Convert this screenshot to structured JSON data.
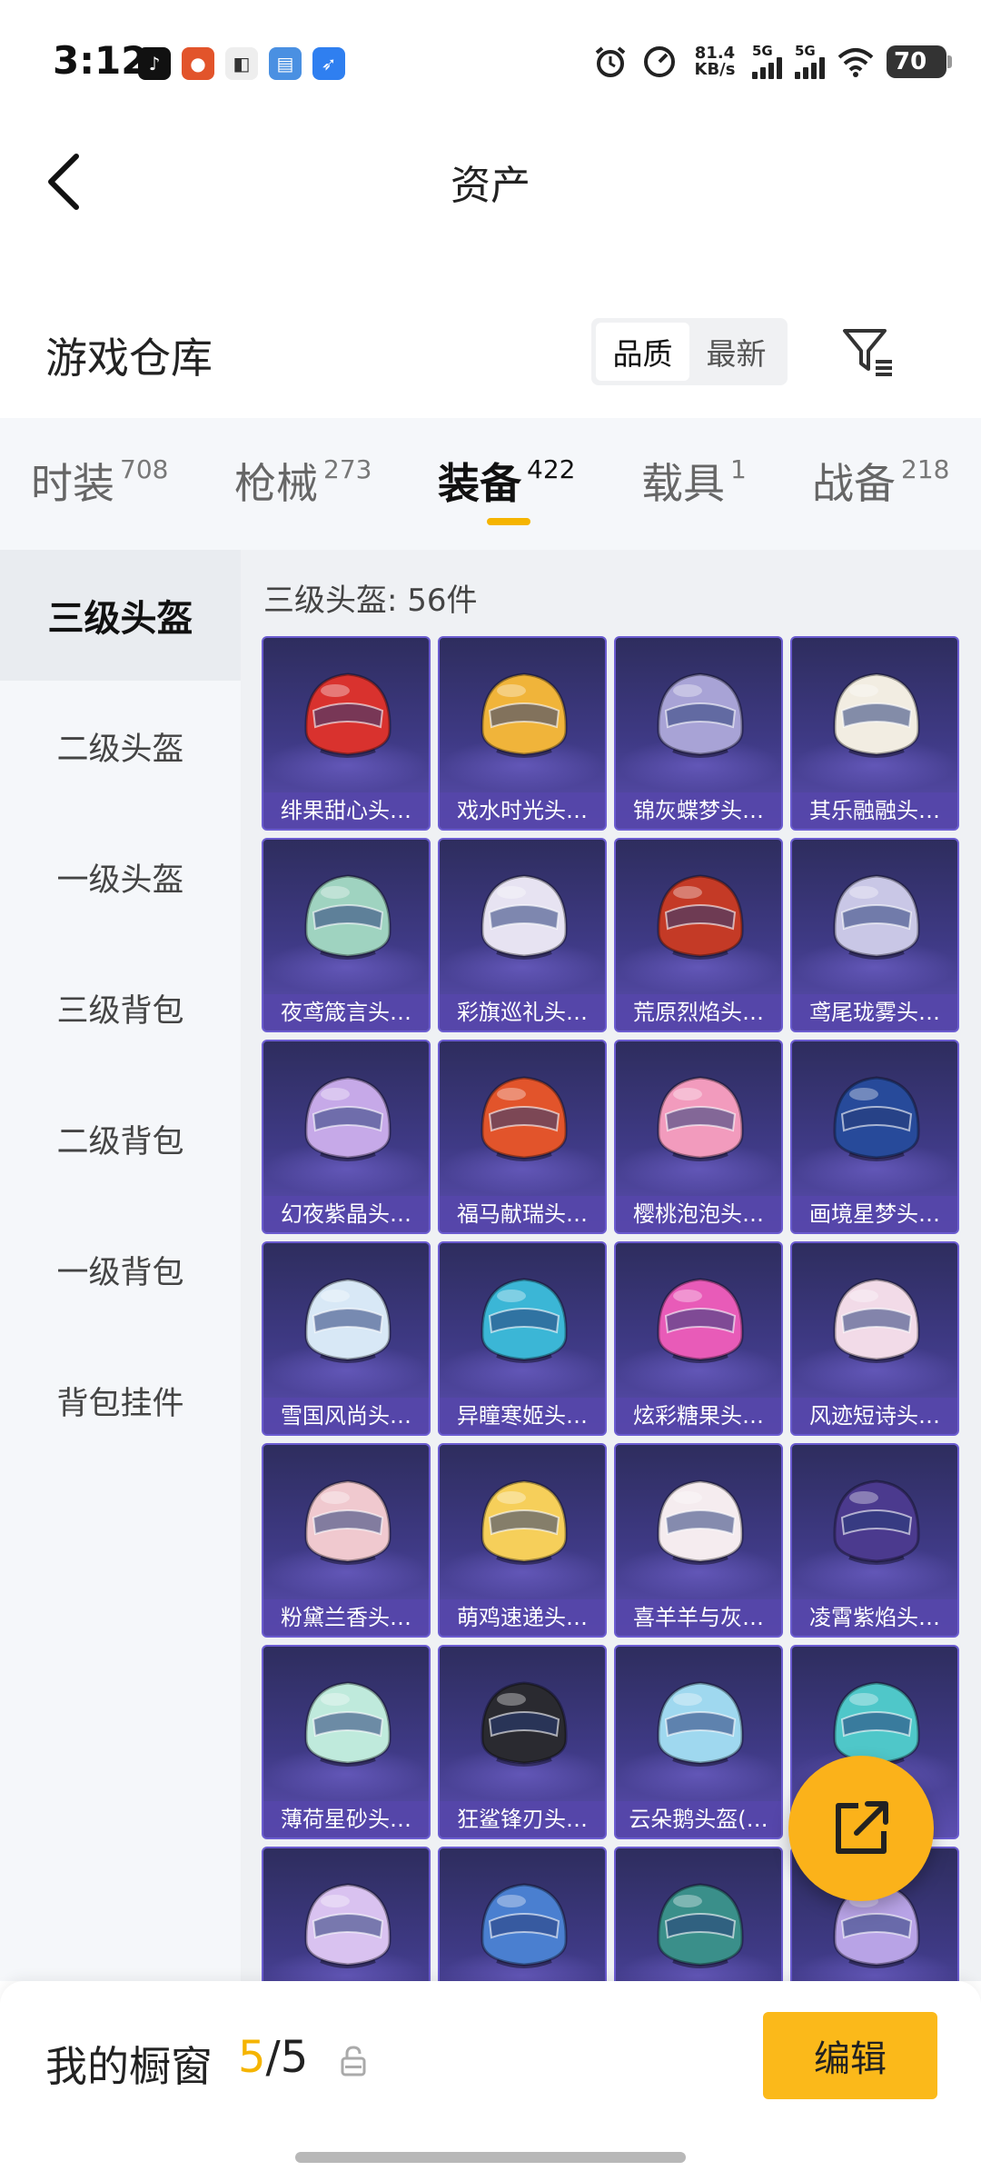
{
  "status_bar": {
    "time": "3:12",
    "net_speed_value": "81.4",
    "net_speed_unit": "KB/s",
    "sim1_label": "5G",
    "sim2_label": "5G",
    "battery": "70",
    "notification_icons": [
      "tiktok-icon",
      "pumpkin-app-icon",
      "app-icon",
      "files-app-icon",
      "feather-app-icon"
    ]
  },
  "header": {
    "title": "资产"
  },
  "section": {
    "title": "游戏仓库",
    "sort_options": [
      "品质",
      "最新"
    ],
    "sort_selected": "品质"
  },
  "tabs": [
    {
      "label": "时装",
      "count": "708"
    },
    {
      "label": "枪械",
      "count": "273"
    },
    {
      "label": "装备",
      "count": "422",
      "active": true
    },
    {
      "label": "载具",
      "count": "1"
    },
    {
      "label": "战备",
      "count": "218"
    }
  ],
  "sidebar": {
    "items": [
      "三级头盔",
      "二级头盔",
      "一级头盔",
      "三级背包",
      "二级背包",
      "一级背包",
      "背包挂件"
    ],
    "active": "三级头盔"
  },
  "grid": {
    "header": "三级头盔: 56件",
    "items": [
      {
        "label": "绯果甜心头…",
        "color": "#d9322e"
      },
      {
        "label": "戏水时光头…",
        "color": "#f0b43a"
      },
      {
        "label": "锦灰蝶梦头…",
        "color": "#a8a3d6"
      },
      {
        "label": "其乐融融头…",
        "color": "#f2ede2"
      },
      {
        "label": "夜鸢箴言头…",
        "color": "#9fd3c0"
      },
      {
        "label": "彩旗巡礼头…",
        "color": "#e7e3f2"
      },
      {
        "label": "荒原烈焰头…",
        "color": "#c43a26"
      },
      {
        "label": "鸢尾珑雾头…",
        "color": "#c9c7e6"
      },
      {
        "label": "幻夜紫晶头…",
        "color": "#c6a9e8"
      },
      {
        "label": "福马献瑞头…",
        "color": "#e2542b"
      },
      {
        "label": "樱桃泡泡头…",
        "color": "#f29bbd"
      },
      {
        "label": "画境星梦头…",
        "color": "#274a9a"
      },
      {
        "label": "雪国风尚头…",
        "color": "#d8e8f6"
      },
      {
        "label": "异瞳寒姬头…",
        "color": "#3bb6d6"
      },
      {
        "label": "炫彩糖果头…",
        "color": "#e85bb8"
      },
      {
        "label": "风迹短诗头…",
        "color": "#f2dbe8"
      },
      {
        "label": "粉黛兰香头…",
        "color": "#f0c9cf"
      },
      {
        "label": "萌鸡速递头…",
        "color": "#f6cf5a"
      },
      {
        "label": "喜羊羊与灰…",
        "color": "#f5ecef"
      },
      {
        "label": "凌霄紫焰头…",
        "color": "#4b3a8e"
      },
      {
        "label": "薄荷星砂头…",
        "color": "#bfeadc"
      },
      {
        "label": "狂鲨锋刃头…",
        "color": "#2a2a30"
      },
      {
        "label": "云朵鹅头盔(…",
        "color": "#9fd8ef"
      },
      {
        "label": "",
        "color": "#4fc7c9"
      },
      {
        "label": "",
        "color": "#d9c2f0"
      },
      {
        "label": "",
        "color": "#4a7fd0"
      },
      {
        "label": "",
        "color": "#3a8f8a"
      },
      {
        "label": "",
        "color": "#b8a3e6"
      }
    ]
  },
  "bottom": {
    "showcase_label": "我的橱窗",
    "current": "5",
    "separator": "/",
    "total": "5",
    "edit_label": "编辑"
  },
  "colors": {
    "accent": "#fbb91a",
    "card_gradient_top": "#2e2d5e",
    "card_gradient_bottom": "#5c4fb0"
  }
}
